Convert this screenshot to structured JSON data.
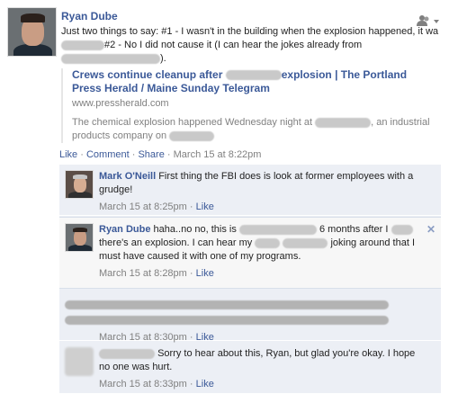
{
  "post": {
    "author": "Ryan Dube",
    "text_part1": "Just two things to say: #1 - I wasn't in the building when the explosion happened, it wa",
    "text_part2": "#2 - No I did not cause it (I can hear the jokes already from",
    "text_part3": ")."
  },
  "link": {
    "title_part1": "Crews continue cleanup after",
    "title_part2": "explosion | The Portland Press Herald / Maine Sunday Telegram",
    "url": "www.pressherald.com",
    "desc_part1": "The chemical explosion happened Wednesday night at",
    "desc_part2": ", an industrial products company on"
  },
  "actions": {
    "like": "Like",
    "comment": "Comment",
    "share": "Share",
    "timestamp": "March 15 at 8:22pm",
    "dot": "·"
  },
  "comments": [
    {
      "name": "Mark O'Neill",
      "text": "First thing the FBI does is look at former employees with a grudge!",
      "time": "March 15 at 8:25pm",
      "like": "Like"
    },
    {
      "name": "Ryan Dube",
      "text_part1": "haha..no no, this is",
      "text_part2": "6 months after I",
      "text_part3": "there's an explosion. I can hear my",
      "text_part4": "joking around that I must have caused it with one of my programs.",
      "time": "March 15 at 8:28pm",
      "like": "Like",
      "close": "✕"
    },
    {
      "time": "March 15 at 8:30pm",
      "like": "Like"
    },
    {
      "text_part1": "Sorry to hear about this, Ryan, but glad you're okay. I hope no one was hurt.",
      "time": "March 15 at 8:33pm",
      "like": "Like"
    }
  ]
}
